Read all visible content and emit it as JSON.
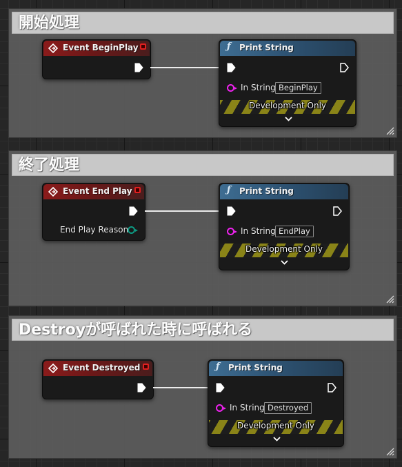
{
  "colors": {
    "canvas": "#262626",
    "comment_box": "#5c5c5c",
    "comment_header": "#c8c8c8",
    "event_header": "#8b1b1b",
    "function_header": "#3e6d92",
    "string_pin": "#ee22ee",
    "enum_pin": "#0d9b84",
    "exec_wire": "#ececec",
    "development_stripe": "#8a8418"
  },
  "comments": [
    {
      "title": "開始処理",
      "event": {
        "icon": "event-diamond-icon",
        "title": "Event BeginPlay"
      },
      "function": {
        "icon": "function-f-icon",
        "title": "Print String",
        "in_string_label": "In String",
        "in_string_value": "BeginPlay",
        "dev_label": "Development Only"
      }
    },
    {
      "title": "終了処理",
      "event": {
        "icon": "event-diamond-icon",
        "title": "Event End Play",
        "output_pin_label": "End Play Reason"
      },
      "function": {
        "icon": "function-f-icon",
        "title": "Print String",
        "in_string_label": "In String",
        "in_string_value": "EndPlay",
        "dev_label": "Development Only"
      }
    },
    {
      "title": "Destroyが呼ばれた時に呼ばれる",
      "event": {
        "icon": "event-diamond-icon",
        "title": "Event Destroyed"
      },
      "function": {
        "icon": "function-f-icon",
        "title": "Print String",
        "in_string_label": "In String",
        "in_string_value": "Destroyed",
        "dev_label": "Development Only"
      }
    }
  ]
}
